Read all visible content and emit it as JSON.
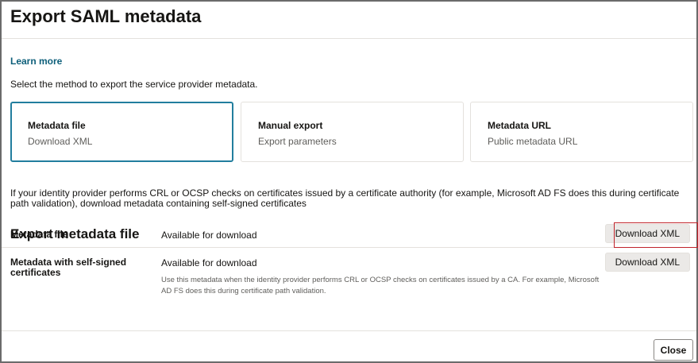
{
  "dialog": {
    "title": "Export SAML metadata",
    "learn_more": "Learn more",
    "intro": "Select the method to export the service provider metadata."
  },
  "cards": [
    {
      "title": "Metadata file",
      "subtitle": "Download XML",
      "selected": true
    },
    {
      "title": "Manual export",
      "subtitle": "Export parameters",
      "selected": false
    },
    {
      "title": "Metadata URL",
      "subtitle": "Public metadata URL",
      "selected": false
    }
  ],
  "note": "If your identity provider performs CRL or OCSP checks on certificates issued by a certificate authority (for example, Microsoft AD FS does this during certificate path validation), download metadata containing self-signed certificates",
  "section": {
    "title": "Export metadata file",
    "rows": [
      {
        "label": "Metadata file",
        "status": "Available for download",
        "button": "Download XML"
      },
      {
        "label": "Metadata with self-signed certificates",
        "status": "Available for download",
        "description": "Use this metadata when the identity provider performs CRL or OCSP checks on certificates issued by a CA. For example, Microsoft AD FS does this during certificate path validation.",
        "button": "Download XML"
      }
    ]
  },
  "footer": {
    "close_label": "Close"
  },
  "colors": {
    "accent": "#227e9e",
    "link": "#0d5f7a",
    "highlight": "#c0232a"
  }
}
